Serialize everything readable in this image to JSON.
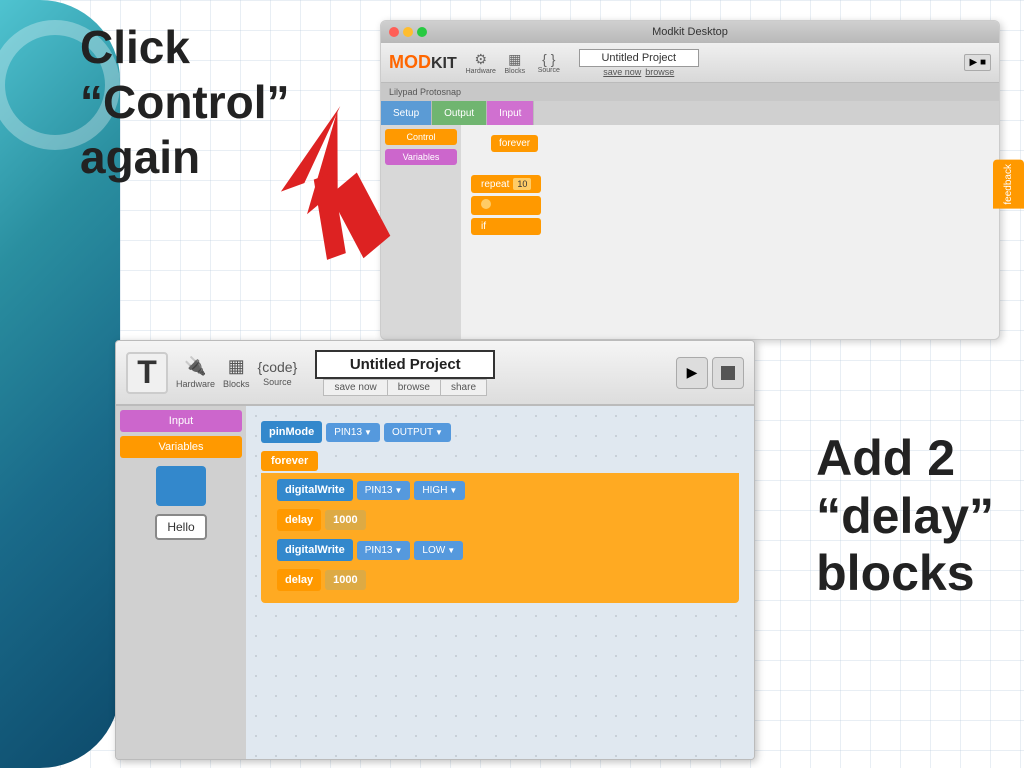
{
  "background": {
    "grid_color": "rgba(180,200,220,0.3)"
  },
  "instruction_top": {
    "line1": "Click",
    "line2": "“Control”",
    "line3": "again"
  },
  "instruction_bottom": {
    "line1": "Add 2",
    "line2": "“delay”",
    "line3": "blocks"
  },
  "screenshot_top": {
    "title_bar": "Modkit Desktop",
    "app_name": "MODKIT",
    "toolbar_items": [
      "Hardware",
      "Blocks",
      "Source"
    ],
    "project_title": "Untitled Project",
    "save_label": "save now",
    "browse_label": "browse",
    "board_label": "Lilypad Protosnap",
    "tabs": [
      "Setup",
      "Output",
      "Input"
    ],
    "sidebar_items": [
      "Control",
      "Variables"
    ],
    "forever_label": "forever",
    "repeat_label": "repeat",
    "repeat_value": "10"
  },
  "screenshot_bottom": {
    "project_title": "Untitled Project",
    "save_label": "save now",
    "browse_label": "browse",
    "share_label": "share",
    "toolbar_items": [
      "Hardware",
      "Blocks",
      "Source"
    ],
    "sidebar_items": [
      "Input",
      "Variables"
    ],
    "hello_label": "Hello",
    "blocks": {
      "pinmode_label": "pinMode",
      "pinmode_pin": "PIN13",
      "pinmode_mode": "OUTPUT",
      "forever_label": "forever",
      "digitalwrite1_label": "digitalWrite",
      "digitalwrite1_pin": "PIN13",
      "digitalwrite1_val": "HIGH",
      "delay1_label": "delay",
      "delay1_val": "1000",
      "digitalwrite2_label": "digitalWrite",
      "digitalwrite2_pin": "PIN13",
      "digitalwrite2_val": "LOW",
      "delay2_label": "delay",
      "delay2_val": "1000"
    }
  },
  "feedback": {
    "label": "feedback"
  }
}
